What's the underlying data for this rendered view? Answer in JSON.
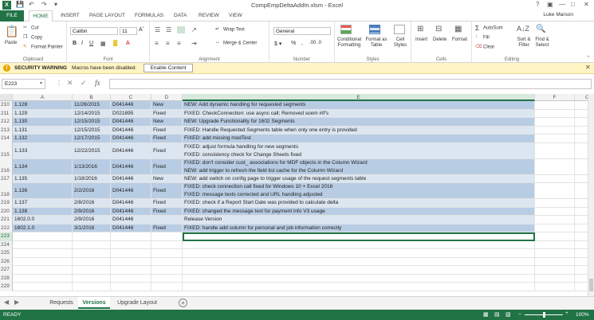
{
  "window": {
    "title": "CompEmpDeltaAddIn.xlsm - Excel",
    "user": "Luke Marson"
  },
  "tabs": [
    "FILE",
    "HOME",
    "INSERT",
    "PAGE LAYOUT",
    "FORMULAS",
    "DATA",
    "REVIEW",
    "VIEW"
  ],
  "ribbon": {
    "clipboard": {
      "paste": "Paste",
      "cut": "Cut",
      "copy": "Copy",
      "format_painter": "Format Painter",
      "label": "Clipboard"
    },
    "font": {
      "name": "Calibri",
      "size": "11",
      "label": "Font"
    },
    "alignment": {
      "wrap": "Wrap Text",
      "merge": "Merge & Center",
      "label": "Alignment"
    },
    "number": {
      "format": "General",
      "label": "Number"
    },
    "styles": {
      "cond": "Conditional Formatting",
      "table": "Format as Table",
      "cell": "Cell Styles",
      "label": "Styles"
    },
    "cells": {
      "insert": "Insert",
      "delete": "Delete",
      "format": "Format",
      "label": "Cells"
    },
    "editing": {
      "autosum": "AutoSum",
      "fill": "Fill",
      "clear": "Clear",
      "sort": "Sort & Filter",
      "find": "Find & Select",
      "label": "Editing"
    }
  },
  "security": {
    "title": "SECURITY WARNING",
    "message": "Macros have been disabled.",
    "button": "Enable Content"
  },
  "formula": {
    "namebox": "E223",
    "fx": "fx"
  },
  "columns": [
    "A",
    "B",
    "C",
    "D",
    "E",
    "F",
    "G"
  ],
  "rows": [
    {
      "n": "210",
      "a": "1.128",
      "b": "11/26/2015",
      "c": "D041446",
      "d": "New",
      "e": "NEW: Add dynamic handling for requested segments",
      "band": 1
    },
    {
      "n": "211",
      "a": "1.129",
      "b": "12/14/2015",
      "c": "D021895",
      "d": "Fixed",
      "e": "FIXED: CheckConnection: use async call; Removed soem #If's",
      "band": 2
    },
    {
      "n": "212",
      "a": "1.130",
      "b": "12/15/2015",
      "c": "D041446",
      "d": "New",
      "e": "NEW: Upgrade Functionality for 1602 Segments",
      "band": 1
    },
    {
      "n": "213",
      "a": "1.131",
      "b": "12/15/2015",
      "c": "D041446",
      "d": "Fixed",
      "e": "FIXED: Handle Requested Segments table when only one entry is provided",
      "band": 2
    },
    {
      "n": "214",
      "a": "1.132",
      "b": "12/17/2015",
      "c": "D041446",
      "d": "Fixed",
      "e": "FIXED: add missing modTest",
      "band": 1
    },
    {
      "n": "215",
      "a": "1.133",
      "b": "12/22/2015",
      "c": "D041446",
      "d": "Fixed",
      "e": "FIXED: adjust formula handling for new segments",
      "e2": "FIXED: consistency check for Change Sheets fixed",
      "band": 2,
      "tall": true
    },
    {
      "n": "216",
      "a": "1.134",
      "b": "1/13/2016",
      "c": "D041446",
      "d": "Fixed",
      "e": "FIXED: don't consider cust_ associations for MDF objects in the Column Wizard",
      "e2": "NEW: add trigger to refresh the field list cache for the Column Wizard",
      "band": 1,
      "tall": true
    },
    {
      "n": "217",
      "a": "1.135",
      "b": "1/18/2016",
      "c": "D041446",
      "d": "New",
      "e": "NEW: add switch on config page to trigger usage of the request segments table",
      "band": 2
    },
    {
      "n": "218",
      "a": "1.136",
      "b": "2/2/2016",
      "c": "D041446",
      "d": "Fixed",
      "e": "FIXED: check connection call fixed for Windows 10 + Excel 2016",
      "e2": "FIXED: message texts corrected and URL handling adjusted",
      "band": 1,
      "tall": true
    },
    {
      "n": "219",
      "a": "1.137",
      "b": "2/8/2016",
      "c": "D041446",
      "d": "Fixed",
      "e": "FIXED: check if a Report Start Date was provided to calculate delta",
      "band": 2
    },
    {
      "n": "220",
      "a": "1.138",
      "b": "2/9/2016",
      "c": "D041446",
      "d": "Fixed",
      "e": "FIXED: changed the message text for payment info V3 usage",
      "band": 1
    },
    {
      "n": "221",
      "a": "1602.0.0",
      "b": "2/9/2016",
      "c": "D041446",
      "d": "",
      "e": "Release Version",
      "band": 2
    },
    {
      "n": "222",
      "a": "1602.1.0",
      "b": "3/1/2016",
      "c": "D041446",
      "d": "Fixed",
      "e": "FIXED: handle add column for personal and job information correctly",
      "band": 1
    },
    {
      "n": "223",
      "a": "",
      "b": "",
      "c": "",
      "d": "",
      "e": "",
      "band": 0
    },
    {
      "n": "224",
      "a": "",
      "b": "",
      "c": "",
      "d": "",
      "e": "",
      "band": 0
    },
    {
      "n": "225",
      "a": "",
      "b": "",
      "c": "",
      "d": "",
      "e": "",
      "band": 0
    },
    {
      "n": "226",
      "a": "",
      "b": "",
      "c": "",
      "d": "",
      "e": "",
      "band": 0
    },
    {
      "n": "227",
      "a": "",
      "b": "",
      "c": "",
      "d": "",
      "e": "",
      "band": 0
    },
    {
      "n": "228",
      "a": "",
      "b": "",
      "c": "",
      "d": "",
      "e": "",
      "band": 0
    },
    {
      "n": "229",
      "a": "",
      "b": "",
      "c": "",
      "d": "",
      "e": "",
      "band": 0
    }
  ],
  "sheets": [
    "Requests",
    "Versions",
    "Upgrade Layout"
  ],
  "status": {
    "left": "READY",
    "zoom": "100%"
  }
}
